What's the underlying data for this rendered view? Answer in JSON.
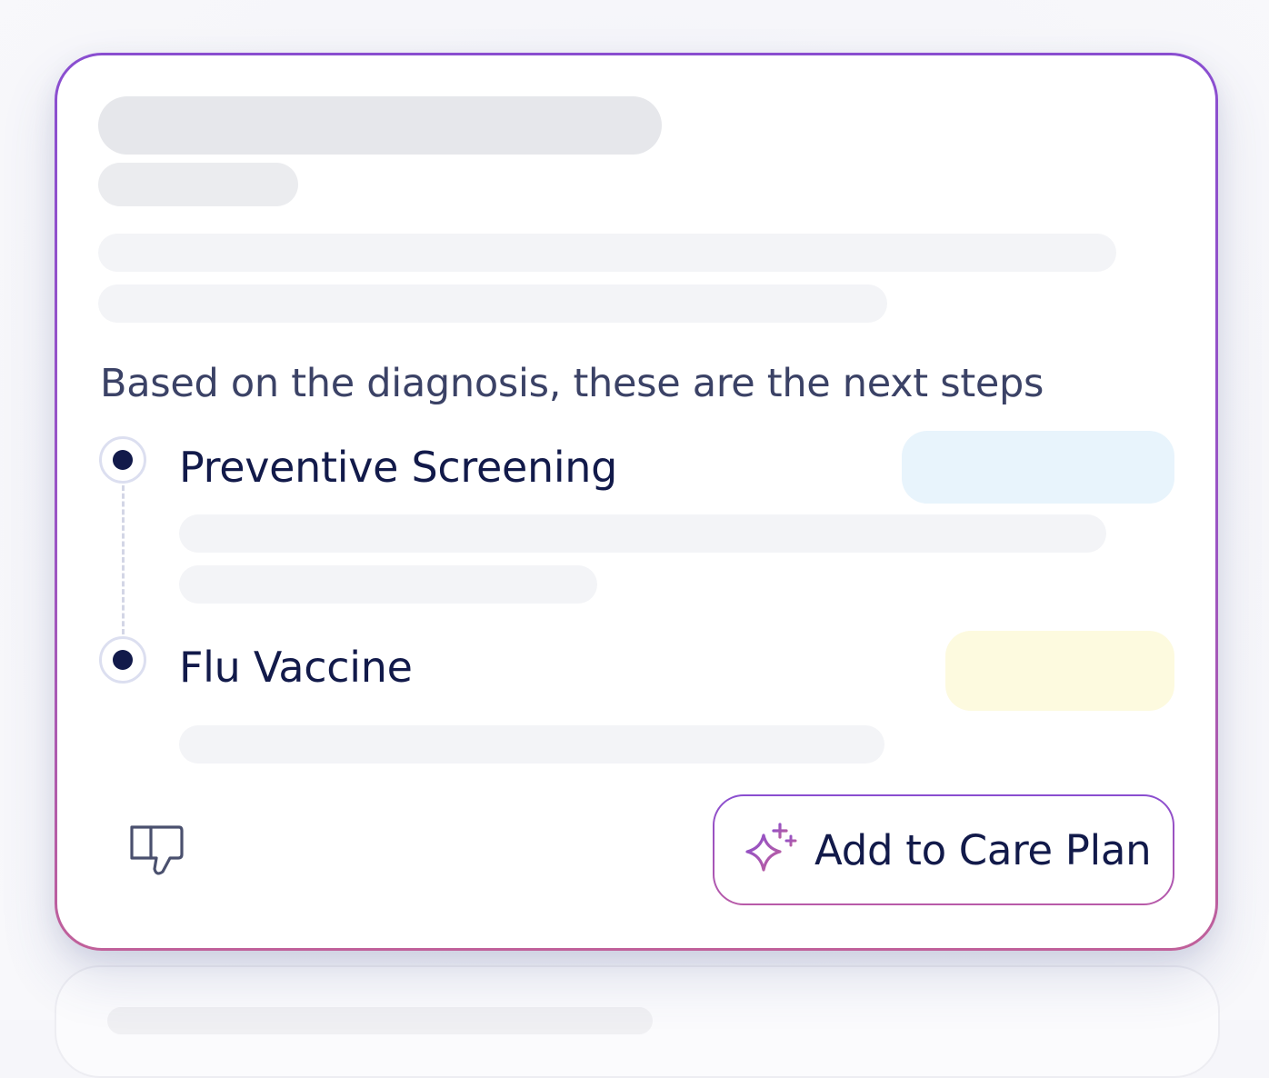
{
  "card": {
    "intro_text": "Based on the diagnosis, these are the next steps",
    "steps": [
      {
        "title": "Preventive Screening",
        "tag_color": "#e8f4fc"
      },
      {
        "title": "Flu Vaccine",
        "tag_color": "#fdfadf"
      }
    ],
    "feedback": {
      "icon": "thumbs-down-icon"
    },
    "cta": {
      "label": "Add to Care Plan",
      "icon": "sparkle-icon"
    }
  },
  "colors": {
    "accent_border_top": "#8a4ed0",
    "accent_border_bottom": "#c0609a",
    "text_primary": "#121a4a",
    "text_secondary": "#3b4266"
  }
}
